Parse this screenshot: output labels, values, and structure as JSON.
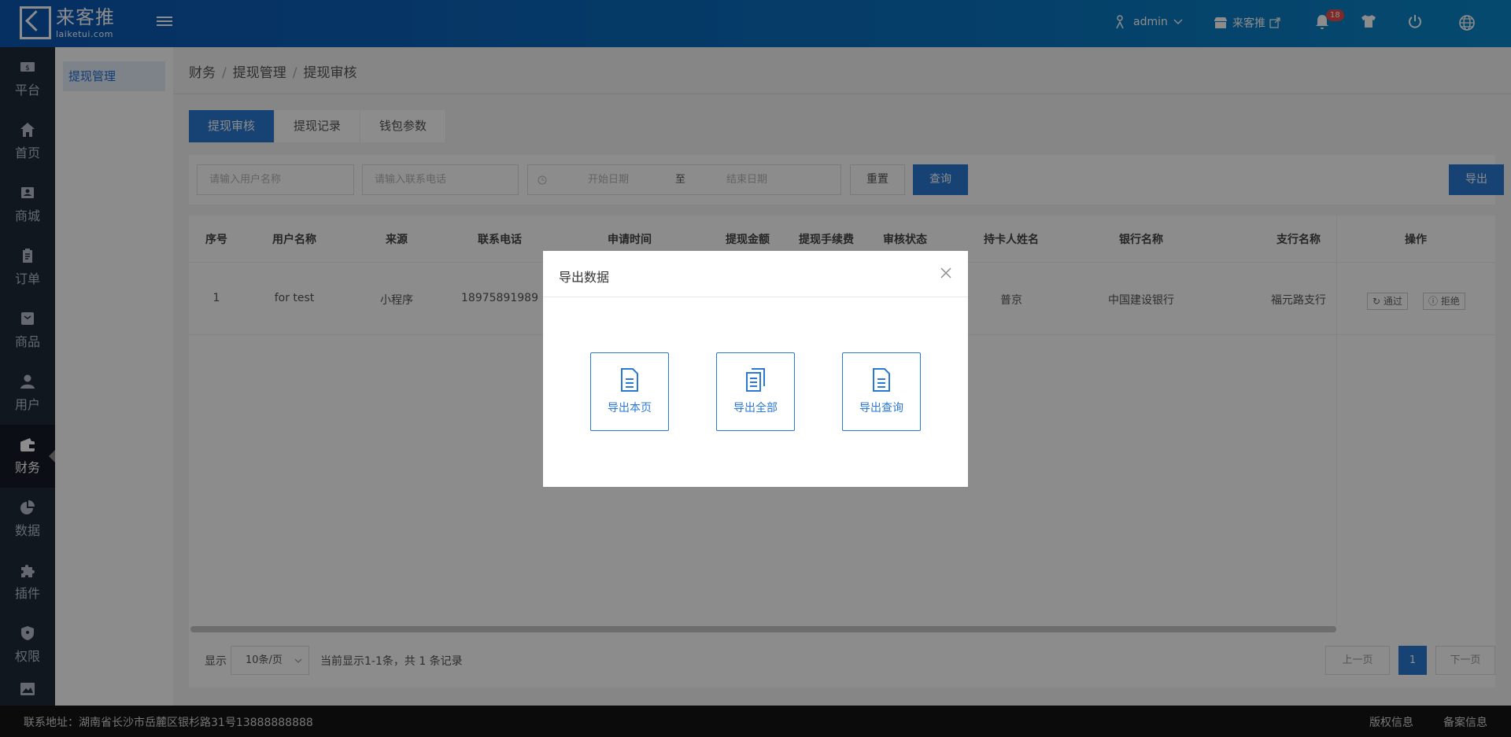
{
  "header": {
    "logo_cn": "来客推",
    "logo_en": "laiketui.com",
    "user": "admin",
    "store": "来客推",
    "notifications": "18",
    "colors": {
      "header_start": "#0b56b3",
      "header_end": "#0a86c9",
      "accent": "#2a78d3",
      "badge": "#e84b4b"
    }
  },
  "sidenav": {
    "items": [
      {
        "label": "平台",
        "icon": "dollar-icon"
      },
      {
        "label": "首页",
        "icon": "home-icon"
      },
      {
        "label": "商城",
        "icon": "store-icon"
      },
      {
        "label": "订单",
        "icon": "clipboard-icon"
      },
      {
        "label": "商品",
        "icon": "box-icon"
      },
      {
        "label": "用户",
        "icon": "user-icon"
      },
      {
        "label": "财务",
        "icon": "wallet-icon",
        "active": true
      },
      {
        "label": "数据",
        "icon": "pie-chart-icon"
      },
      {
        "label": "插件",
        "icon": "puzzle-icon"
      },
      {
        "label": "权限",
        "icon": "shield-icon"
      }
    ]
  },
  "subnav": {
    "item": "提现管理"
  },
  "breadcrumb": {
    "l1": "财务",
    "l2": "提现管理",
    "l3": "提现审核",
    "sep": "/"
  },
  "tabs": [
    "提现审核",
    "提现记录",
    "钱包参数"
  ],
  "filter": {
    "username_placeholder": "请输入用户名称",
    "phone_placeholder": "请输入联系电话",
    "start_date": "开始日期",
    "to": "至",
    "end_date": "结束日期",
    "reset": "重置",
    "query": "查询",
    "export": "导出"
  },
  "table": {
    "headers": [
      "序号",
      "用户名称",
      "来源",
      "联系电话",
      "申请时间",
      "提现金额",
      "提现手续费",
      "审核状态",
      "持卡人姓名",
      "银行名称",
      "支行名称",
      "操作"
    ],
    "row": {
      "index": "1",
      "name": "for test",
      "source": "小程序",
      "phone": "18975891989",
      "holder": "普京",
      "bank": "中国建设银行",
      "branch": "福元路支行",
      "approve": "通过",
      "reject": "拒绝"
    }
  },
  "pager": {
    "show": "显示",
    "page_size": "10条/页",
    "summary": "当前显示1-1条，共 1 条记录",
    "prev": "上一页",
    "current": "1",
    "next": "下一页"
  },
  "footer": {
    "address": "联系地址：湖南省长沙市岳麓区银杉路31号13888888888",
    "copyright": "版权信息",
    "icp": "备案信息"
  },
  "modal": {
    "title": "导出数据",
    "options": [
      "导出本页",
      "导出全部",
      "导出查询"
    ]
  }
}
